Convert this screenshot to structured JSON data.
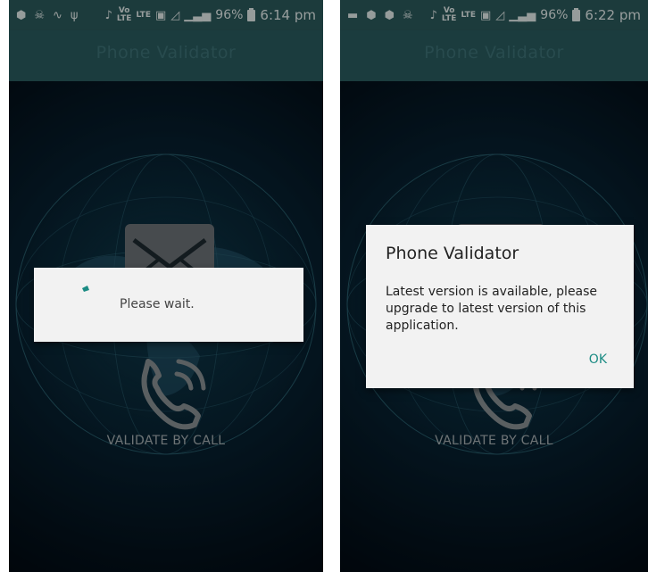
{
  "screens": [
    {
      "status_bar": {
        "battery": "96%",
        "time": "6:14 pm"
      },
      "app_title": "Phone Validator",
      "validate_label": "VALIDATE BY CALL",
      "progress_dialog": {
        "message": "Please wait."
      }
    },
    {
      "status_bar": {
        "battery": "96%",
        "time": "6:22 pm"
      },
      "app_title": "Phone Validator",
      "validate_label": "VALIDATE BY CALL",
      "alert_dialog": {
        "title": "Phone Validator",
        "message": "Latest version is available, please upgrade to latest version of this application.",
        "ok_label": "OK"
      }
    }
  ],
  "colors": {
    "app_bar": "#2a5c60",
    "status_bar": "#2c5b5c",
    "accent": "#1c8c84",
    "background": "#061522"
  },
  "icons": [
    "shield-icon",
    "mail-icon",
    "phone-call-icon",
    "signal-icon",
    "wifi-icon",
    "battery-icon"
  ]
}
